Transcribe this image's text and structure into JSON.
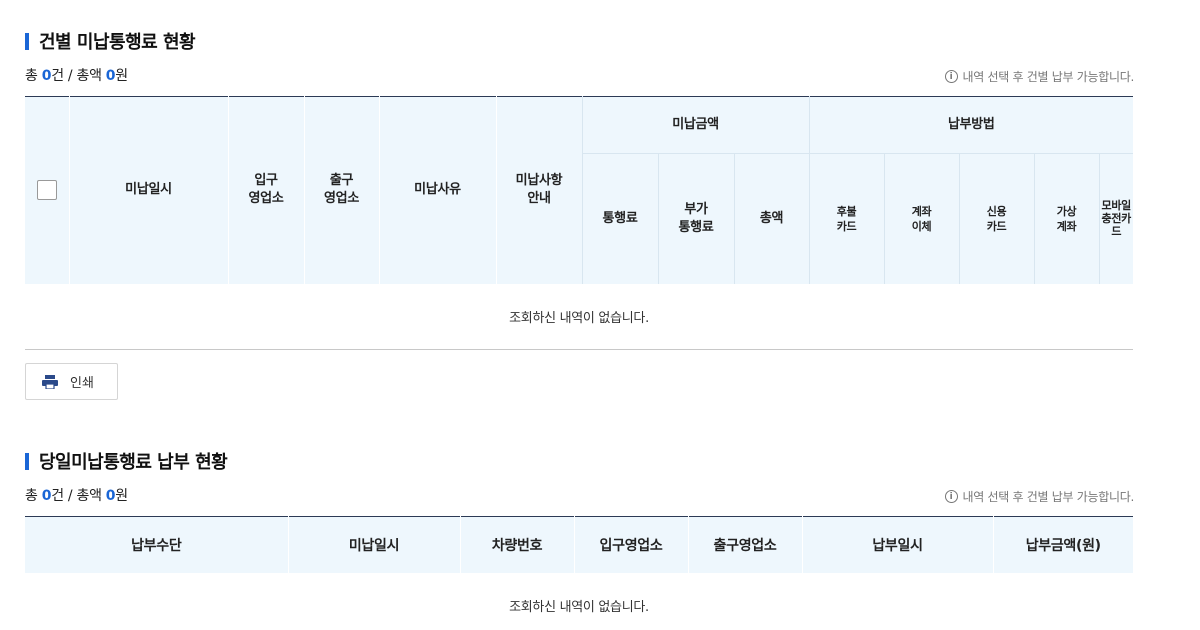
{
  "section1": {
    "title": "건별 미납통행료 현황",
    "summary": {
      "prefix": "총 ",
      "count": "0",
      "mid": "건 / 총액 ",
      "amount": "0",
      "suffix": "원"
    },
    "notice_icon": "info-icon",
    "notice": "내역 선택 후 건별 납부 가능합니다.",
    "headers": {
      "unpaid_datetime": "미납일시",
      "entry_office": "입구\n영업소",
      "exit_office": "출구\n영업소",
      "unpaid_reason": "미납사유",
      "unpaid_guide": "미납사항\n안내",
      "unpaid_amount_group": "미납금액",
      "toll": "통행료",
      "extra_toll": "부가\n통행료",
      "total": "총액",
      "payment_method_group": "납부방법",
      "deferred_card": "후불\n카드",
      "account_transfer": "계좌\n이체",
      "credit_card": "신용\n카드",
      "virtual_account": "가상\n계좌",
      "mobile_card": "모바일충전카드"
    },
    "empty_message": "조회하신 내역이 없습니다."
  },
  "print_button": {
    "icon": "printer-icon",
    "label": "인쇄"
  },
  "section2": {
    "title": "당일미납통행료 납부 현황",
    "summary": {
      "prefix": "총 ",
      "count": "0",
      "mid": "건 / 총액 ",
      "amount": "0",
      "suffix": "원"
    },
    "notice_icon": "info-icon",
    "notice": "내역 선택 후 건별 납부 가능합니다.",
    "headers": [
      "납부수단",
      "미납일시",
      "차량번호",
      "입구영업소",
      "출구영업소",
      "납부일시",
      "납부금액(원)"
    ],
    "empty_message": "조회하신 내역이 없습니다."
  },
  "colors": {
    "accent": "#1a66d6",
    "header_bg": "#eef7fd",
    "table_top_border": "#2c3a55"
  }
}
